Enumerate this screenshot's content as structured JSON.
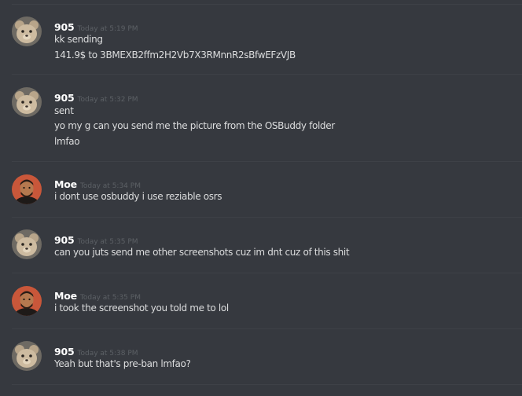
{
  "messages": [
    {
      "author": "905",
      "avatar": "teddy-bear-avatar",
      "timestamp": "Today at 5:19 PM",
      "lines": [
        "kk sending",
        "141.9$ to 3BMEXB2ffm2H2Vb7X3RMnnR2sBfwEFzVJB"
      ]
    },
    {
      "author": "905",
      "avatar": "teddy-bear-avatar",
      "timestamp": "Today at 5:32 PM",
      "lines": [
        "sent",
        "yo my g can you send me the picture from the OSBuddy folder",
        "lmfao"
      ]
    },
    {
      "author": "Moe",
      "avatar": "person-avatar",
      "timestamp": "Today at 5:34 PM",
      "lines": [
        "i dont use osbuddy i use reziable osrs"
      ]
    },
    {
      "author": "905",
      "avatar": "teddy-bear-avatar",
      "timestamp": "Today at 5:35 PM",
      "lines": [
        "can you juts send me other screenshots cuz im dnt cuz of this shit"
      ]
    },
    {
      "author": "Moe",
      "avatar": "person-avatar",
      "timestamp": "Today at 5:35 PM",
      "lines": [
        "i took the screenshot you told me to lol"
      ]
    },
    {
      "author": "905",
      "avatar": "teddy-bear-avatar",
      "timestamp": "Today at 5:38 PM",
      "lines": [
        "Yeah but that's pre-ban lmfao?"
      ]
    }
  ],
  "colors": {
    "background": "#36393f",
    "username": "#ffffff",
    "message_text": "#dcddde",
    "timestamp": "#5c6065",
    "divider": "#3e4147"
  }
}
